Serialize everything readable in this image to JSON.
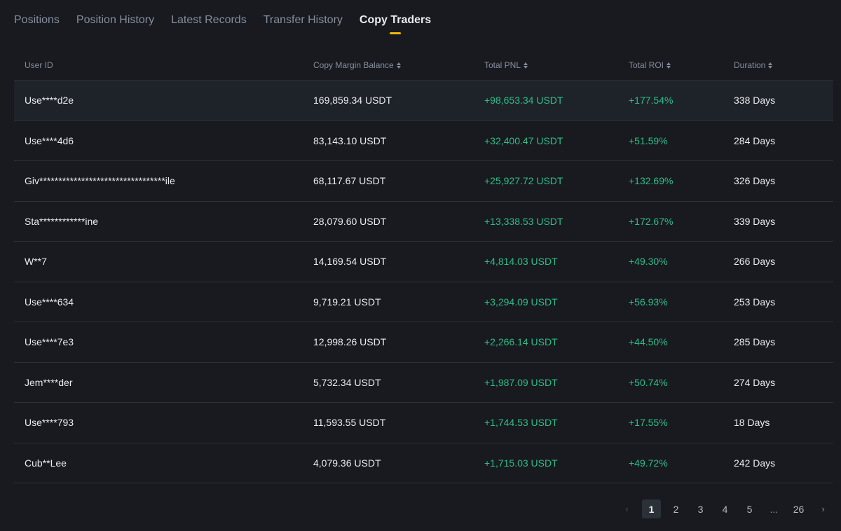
{
  "tabs": [
    {
      "label": "Positions",
      "active": false
    },
    {
      "label": "Position History",
      "active": false
    },
    {
      "label": "Latest Records",
      "active": false
    },
    {
      "label": "Transfer History",
      "active": false
    },
    {
      "label": "Copy Traders",
      "active": true
    }
  ],
  "table": {
    "headers": {
      "user_id": "User ID",
      "copy_margin_balance": "Copy Margin Balance",
      "total_pnl": "Total PNL",
      "total_roi": "Total ROI",
      "duration": "Duration"
    },
    "rows": [
      {
        "user_id": "Use****d2e",
        "balance": "169,859.34 USDT",
        "pnl": "+98,653.34 USDT",
        "roi": "+177.54%",
        "duration": "338 Days"
      },
      {
        "user_id": "Use****4d6",
        "balance": "83,143.10 USDT",
        "pnl": "+32,400.47 USDT",
        "roi": "+51.59%",
        "duration": "284 Days"
      },
      {
        "user_id": "Giv*********************************ile",
        "balance": "68,117.67 USDT",
        "pnl": "+25,927.72 USDT",
        "roi": "+132.69%",
        "duration": "326 Days"
      },
      {
        "user_id": "Sta************ine",
        "balance": "28,079.60 USDT",
        "pnl": "+13,338.53 USDT",
        "roi": "+172.67%",
        "duration": "339 Days"
      },
      {
        "user_id": "W**7",
        "balance": "14,169.54 USDT",
        "pnl": "+4,814.03 USDT",
        "roi": "+49.30%",
        "duration": "266 Days"
      },
      {
        "user_id": "Use****634",
        "balance": "9,719.21 USDT",
        "pnl": "+3,294.09 USDT",
        "roi": "+56.93%",
        "duration": "253 Days"
      },
      {
        "user_id": "Use****7e3",
        "balance": "12,998.26 USDT",
        "pnl": "+2,266.14 USDT",
        "roi": "+44.50%",
        "duration": "285 Days"
      },
      {
        "user_id": "Jem****der",
        "balance": "5,732.34 USDT",
        "pnl": "+1,987.09 USDT",
        "roi": "+50.74%",
        "duration": "274 Days"
      },
      {
        "user_id": "Use****793",
        "balance": "11,593.55 USDT",
        "pnl": "+1,744.53 USDT",
        "roi": "+17.55%",
        "duration": "18 Days"
      },
      {
        "user_id": "Cub**Lee",
        "balance": "4,079.36 USDT",
        "pnl": "+1,715.03 USDT",
        "roi": "+49.72%",
        "duration": "242 Days"
      }
    ]
  },
  "pagination": {
    "prev_icon": "chevron-left-icon",
    "next_icon": "chevron-right-icon",
    "pages": [
      "1",
      "2",
      "3",
      "4",
      "5",
      "...",
      "26"
    ],
    "current": "1"
  },
  "colors": {
    "background": "#181a20",
    "accent": "#f0b90b",
    "positive": "#2ebd85",
    "muted": "#848e9c"
  }
}
